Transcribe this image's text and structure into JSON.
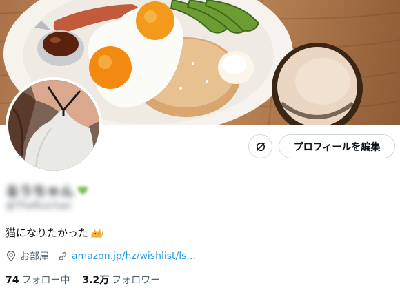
{
  "profile": {
    "display_name": "るうちゃん",
    "handle": "@TheRuichan",
    "bio_text": "猫になりたかった",
    "bio_emoji": "cat-emoji",
    "location": "お部屋",
    "website": "amazon.jp/hz/wishlist/ls...",
    "following_count": "74",
    "following_label": "フォロー中",
    "followers_count": "3.2万",
    "followers_label": "フォロワー"
  },
  "actions": {
    "edit_profile_label": "プロフィールを編集",
    "more_icon": "link-off-icon"
  },
  "icons": {
    "location_icon": "location-pin-icon",
    "link_icon": "link-icon"
  },
  "colors": {
    "accent": "#1d9bf0",
    "text_primary": "#0f1419",
    "text_secondary": "#536471",
    "border": "#cfd9de",
    "name_badge": "#6fbf4a"
  }
}
